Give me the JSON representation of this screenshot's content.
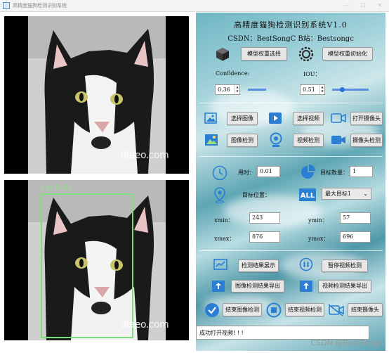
{
  "window": {
    "title": "高精度猫狗检测识别系统",
    "minimize": "—",
    "maximize": "☐",
    "close": "✕"
  },
  "images": {
    "top_watermark": "dlaeo.com",
    "bottom_watermark": "dlaeo.com",
    "detection_label": "cat  0.41"
  },
  "header": {
    "title": "高精度猫狗检测识别系统V1.0",
    "subtitle": "CSDN：BestSongC   B站：Bestsongc"
  },
  "model": {
    "select_weights": "模型权重选择",
    "init_weights": "模型权重初始化"
  },
  "thresholds": {
    "confidence_label": "Confidence:",
    "confidence_value": "0.36",
    "confidence_level": 0.36,
    "iou_label": "IOU：",
    "iou_value": "0.51",
    "iou_level": 0.51
  },
  "actions": {
    "select_image": "选择图像",
    "select_video": "选择视频",
    "open_camera": "打开摄像头",
    "image_detect": "图像检测",
    "video_detect": "视频检测",
    "camera_detect": "摄像头检测"
  },
  "results": {
    "time_label": "用时：",
    "time_value": "0.01",
    "count_label": "目标数量：",
    "count_value": "1",
    "position_label": "目标位置：",
    "target_select": "最大目标1",
    "xmin_label": "xmin：",
    "xmin_value": "243",
    "ymin_label": "ymin：",
    "ymin_value": "57",
    "xmax_label": "xmax：",
    "xmax_value": "876",
    "ymax_label": "ymax：",
    "ymax_value": "696"
  },
  "controls": {
    "show_results": "检测结果展示",
    "pause_video": "暂停视频检测",
    "export_image": "图像检测结果导出",
    "export_video": "视频检测结果导出",
    "stop_image": "结束图像检测",
    "stop_video": "结束视频检测",
    "stop_camera": "结束摄像头"
  },
  "status": {
    "message": "成功打开视频! ! !"
  },
  "footer": {
    "csdn_watermark": "CSDN @BestSongC"
  },
  "colors": {
    "accent_blue": "#2a7fd4",
    "bbox_green": "#7fdc7f",
    "panel_teal": "#6fb6c3"
  }
}
